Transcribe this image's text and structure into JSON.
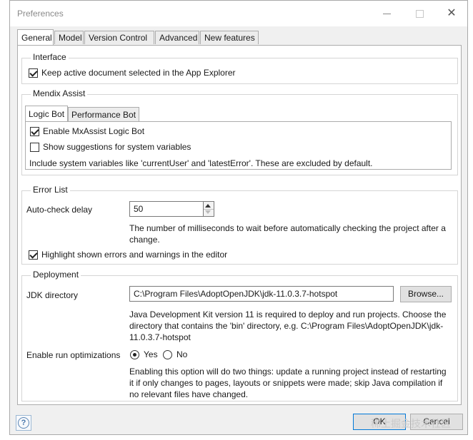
{
  "window": {
    "title": "Preferences"
  },
  "tabs": [
    "General",
    "Model",
    "Version Control",
    "Advanced",
    "New features"
  ],
  "interface": {
    "group_label": "Interface",
    "keep_active_label": "Keep active document selected in the App Explorer",
    "keep_active_checked": true
  },
  "assist": {
    "group_label": "Mendix Assist",
    "subtabs": [
      "Logic Bot",
      "Performance Bot"
    ],
    "enable_label": "Enable MxAssist Logic Bot",
    "enable_checked": true,
    "suggest_label": "Show suggestions for system variables",
    "suggest_checked": false,
    "note": "Include system variables like 'currentUser' and 'latestError'. These are excluded by default."
  },
  "errors": {
    "group_label": "Error List",
    "delay_label": "Auto-check delay",
    "delay_value": "50",
    "delay_help": "The number of milliseconds to wait before automatically checking the project after a change.",
    "highlight_label": "Highlight shown errors and warnings in the editor",
    "highlight_checked": true
  },
  "deployment": {
    "group_label": "Deployment",
    "jdk_label": "JDK directory",
    "jdk_value": "C:\\Program Files\\AdoptOpenJDK\\jdk-11.0.3.7-hotspot",
    "browse_label": "Browse...",
    "jdk_help": "Java Development Kit version 11 is required to deploy and run projects. Choose the directory that contains the 'bin' directory, e.g. C:\\Program Files\\AdoptOpenJDK\\jdk-11.0.3.7-hotspot",
    "runopt_label": "Enable run optimizations",
    "yes_label": "Yes",
    "no_label": "No",
    "runopt_selected": "Yes",
    "runopt_help": "Enabling this option will do two things: update a running project instead of restarting it if only changes to pages, layouts or snippets were made; skip Java compilation if no relevant files have changed."
  },
  "footer": {
    "help_glyph": "?",
    "ok_label": "OK",
    "cancel_label": "Cancel",
    "watermark": "稀土掘金技术社区"
  },
  "colors": {
    "accent": "#0078d7",
    "window_bg": "#f0f0f0"
  }
}
